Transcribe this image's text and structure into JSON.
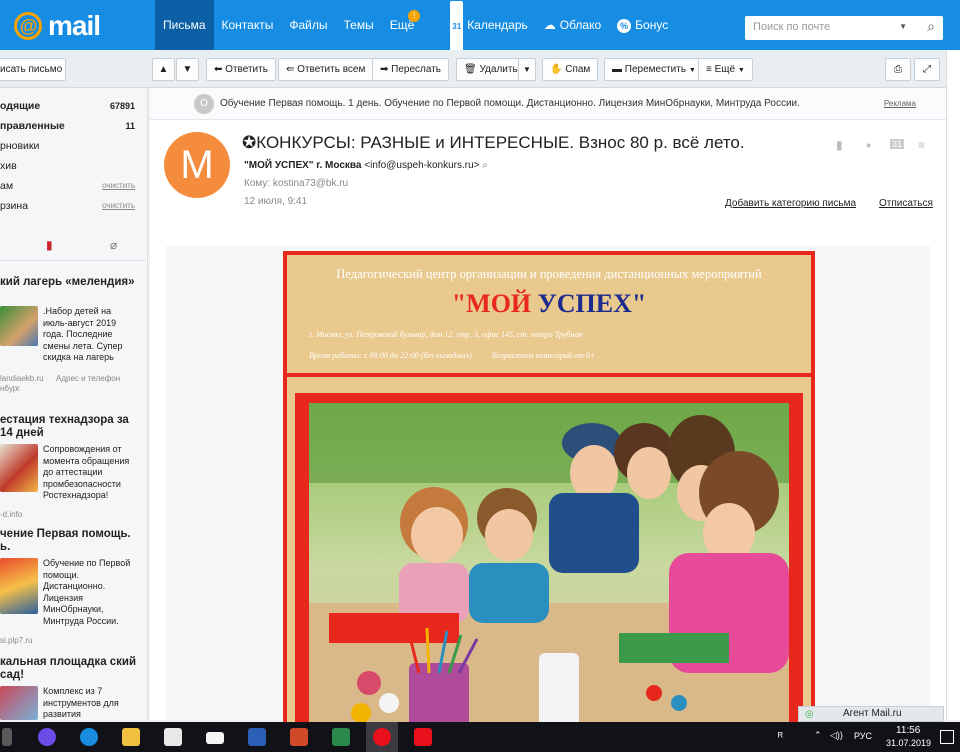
{
  "logo": {
    "text": "mail",
    "at": "@"
  },
  "nav": [
    {
      "label": "Письма",
      "active": true
    },
    {
      "label": "Контакты"
    },
    {
      "label": "Файлы"
    },
    {
      "label": "Темы"
    },
    {
      "label": "Ещё",
      "badge": "!"
    },
    {
      "label": "Календарь",
      "icon": "31"
    },
    {
      "label": "Облако",
      "icon": "cloud-icon"
    },
    {
      "label": "Бонус",
      "icon": "percent-icon"
    }
  ],
  "search": {
    "placeholder": "Поиск по почте"
  },
  "compose": "исать письмо",
  "toolbar": {
    "reply": "Ответить",
    "reply_all": "Ответить всем",
    "forward": "Переслать",
    "delete": "Удалить",
    "spam": "Спам",
    "move": "Переместить",
    "more": "Ещё"
  },
  "folders": [
    {
      "label": "одящие",
      "count": "67891",
      "bold": true
    },
    {
      "label": "правленные",
      "count": "11",
      "bold": true
    },
    {
      "label": "рновики"
    },
    {
      "label": "хив"
    },
    {
      "label": "ам",
      "clear": "очистить"
    },
    {
      "label": "рзина",
      "clear": "очистить"
    }
  ],
  "ads": [
    {
      "title": "кий лагерь «мелендия»",
      "text": ".Набор детей на июль-август 2019 года. Последние смены лета. Супер скидка на лагерь",
      "src": "landiaekb.ru",
      "src2": "Адрес и телефон",
      "src3": "нбург"
    },
    {
      "title": "естация технадзора за 14 дней",
      "text": "Сопровождения от момента обращения до аттестации промбезопасности Ростехнадзора!",
      "src": "-d.info"
    },
    {
      "title": "чение Первая помощь. ь.",
      "text": "Обучение по Первой помощи. Дистанционно. Лицензия МинОбрнауки, Минтруда России.",
      "src": "si.plp7.ru"
    },
    {
      "title": "кальная площадка ский сад!",
      "text": "Комплекс из 7 инструментов для развития"
    }
  ],
  "adline": {
    "text": "Обучение Первая помощь. 1 день.   Обучение по Первой помощи. Дистанционно. Лицензия МинОбрнауки, Минтруда России.",
    "tag": "Реклама",
    "avatar": "О"
  },
  "message": {
    "avatar": "M",
    "subject": "✪КОНКУРСЫ: РАЗНЫЕ и ИНТЕРЕСНЫЕ. Взнос 80 р. всё лето.",
    "from_name": "\"МОЙ УСПЕХ\" г. Москва",
    "from_email": "<info@uspeh-konkurs.ru>",
    "to": "Кому: kostina73@bk.ru",
    "date": "12 июля, 9:41",
    "add_category": "Добавить категорию письма",
    "unsubscribe": "Отписаться"
  },
  "letter": {
    "line1": "Педагогический центр организации и проведения дистанционных мероприятий",
    "brand_a": "\"МОЙ ",
    "brand_b": "УСПЕХ\"",
    "address": "г. Москва, ул. Петровский бульвар, дом 12, стр. 3, офис 145, ст. метро Трубная",
    "hours": "Время работы: с 09:00 до 22:00 (без выходных)",
    "ages": "Возрастных категорий от 0+"
  },
  "agent": "Агент Mail.ru",
  "tray": {
    "lang": "РУС",
    "time": "11:56",
    "date": "31.07.2019"
  },
  "colors": {
    "brand_blue": "#168de2",
    "accent_orange": "#f8a300",
    "letter_red": "#e8281d",
    "letter_sand": "#e9c98d"
  }
}
